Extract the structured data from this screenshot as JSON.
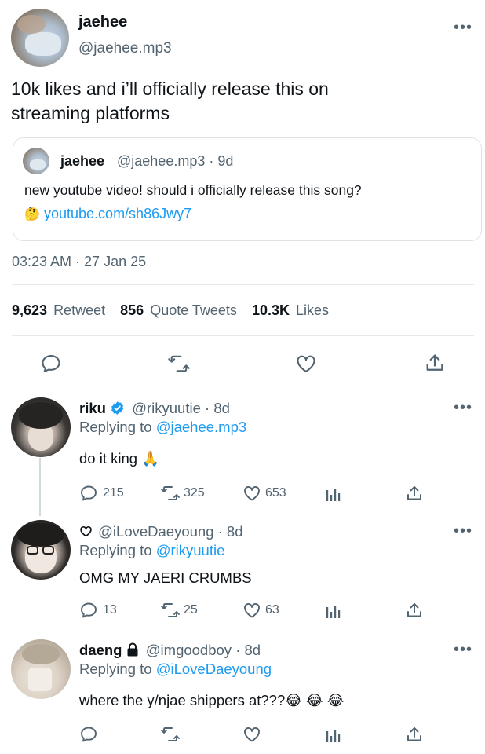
{
  "main_tweet": {
    "display_name": "jaehee",
    "handle": "@jaehee.mp3",
    "text_line1": "10k likes and i’ll officially release this on",
    "text_line2": "streaming platforms",
    "timestamp": "03:23 AM · 27 Jan 25",
    "quoted": {
      "display_name": "jaehee",
      "handle_time": "@jaehee.mp3 · 9d",
      "text": "new youtube video! should i officially release this song?",
      "emoji": "🤔",
      "link": "youtube.com/sh86Jwy7"
    },
    "stats": {
      "retweets": "9,623",
      "retweets_label": "Retweet",
      "quotes": "856",
      "quotes_label": "Quote Tweets",
      "likes": "10.3K",
      "likes_label": "Likes"
    }
  },
  "replies": [
    {
      "display_name": "riku",
      "handle_time": "@rikyuutie · 8d",
      "replying_prefix": "Replying to ",
      "replying_to": "@jaehee.mp3",
      "text": "do it king 🙏",
      "replies": "215",
      "retweets": "325",
      "likes": "653"
    },
    {
      "display_name": "",
      "handle_time": "@iLoveDaeyoung · 8d",
      "replying_prefix": "Replying to ",
      "replying_to": "@rikyuutie",
      "text": "OMG MY JAERI CRUMBS",
      "replies": "13",
      "retweets": "25",
      "likes": "63"
    },
    {
      "display_name": "daeng",
      "handle_time": "@imgoodboy · 8d",
      "replying_prefix": "Replying to ",
      "replying_to": "@iLoveDaeyoung",
      "text": "where the y/njae shippers at???😂 😂 😂",
      "replies": "",
      "retweets": "",
      "likes": ""
    }
  ],
  "colors": {
    "accent": "#1d9bf0",
    "text": "#0f1419",
    "secondary": "#536471",
    "divider": "#e6e9ec"
  }
}
